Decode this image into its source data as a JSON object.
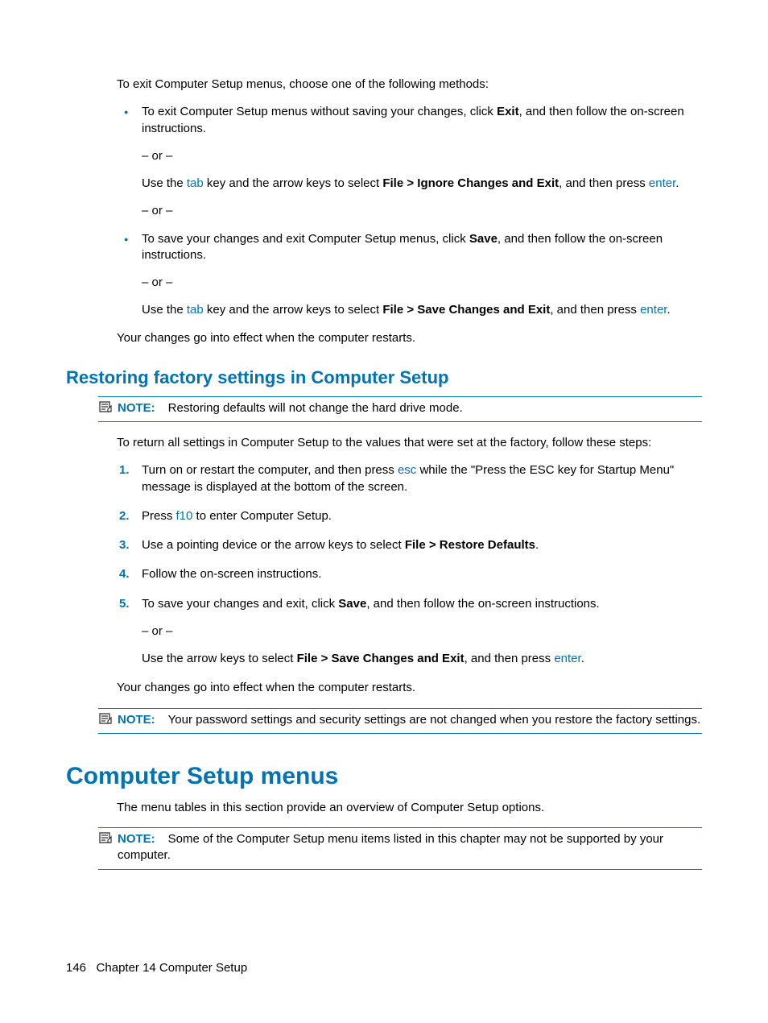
{
  "intro": "To exit Computer Setup menus, choose one of the following methods:",
  "bullet1": {
    "a": "To exit Computer Setup menus without saving your changes, click ",
    "exit": "Exit",
    "b": ", and then follow the on-screen instructions.",
    "or": "– or –",
    "c1": "Use the ",
    "tab": "tab",
    "c2": " key and the arrow keys to select ",
    "file": "File > Ignore Changes and Exit",
    "c3": ", and then press ",
    "enter": "enter",
    "period": "."
  },
  "bullet2": {
    "a": "To save your changes and exit Computer Setup menus, click ",
    "save": "Save",
    "b": ", and then follow the on-screen instructions.",
    "or": "– or –",
    "c1": "Use the ",
    "tab": "tab",
    "c2": " key and the arrow keys to select ",
    "file": "File > Save Changes and Exit",
    "c3": ", and then press ",
    "enter": "enter",
    "period": "."
  },
  "after_bullets": "Your changes go into effect when the computer restarts.",
  "h2": "Restoring factory settings in Computer Setup",
  "note1": {
    "label": "NOTE:",
    "text": "Restoring defaults will not change the hard drive mode."
  },
  "restore_intro": "To return all settings in Computer Setup to the values that were set at the factory, follow these steps:",
  "steps": {
    "s1a": "Turn on or restart the computer, and then press ",
    "s1esc": "esc",
    "s1b": " while the \"Press the ESC key for Startup Menu\" message is displayed at the bottom of the screen.",
    "s2a": "Press ",
    "s2f10": "f10",
    "s2b": " to enter Computer Setup.",
    "s3a": "Use a pointing device or the arrow keys to select ",
    "s3file": "File > Restore Defaults",
    "s3b": ".",
    "s4": "Follow the on-screen instructions.",
    "s5a": "To save your changes and exit, click ",
    "s5save": "Save",
    "s5b": ", and then follow the on-screen instructions.",
    "s5or": "– or –",
    "s5c1": "Use the arrow keys to select ",
    "s5file": "File > Save Changes and Exit",
    "s5c2": ", and then press ",
    "s5enter": "enter",
    "s5period": "."
  },
  "after_steps": "Your changes go into effect when the computer restarts.",
  "note2": {
    "label": "NOTE:",
    "text": "Your password settings and security settings are not changed when you restore the factory settings."
  },
  "h1": "Computer Setup menus",
  "menus_intro": "The menu tables in this section provide an overview of Computer Setup options.",
  "note3": {
    "label": "NOTE:",
    "text": "Some of the Computer Setup menu items listed in this chapter may not be supported by your computer."
  },
  "footer": {
    "page": "146",
    "chapter": "Chapter 14   Computer Setup"
  }
}
